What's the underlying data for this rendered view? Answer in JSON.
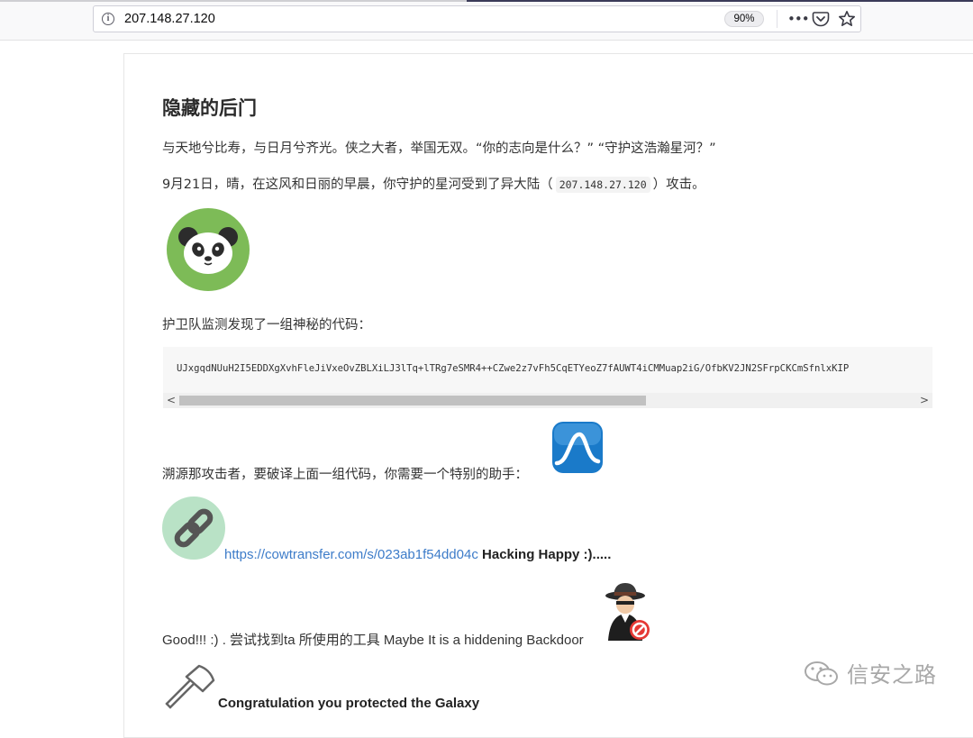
{
  "browser": {
    "url": "207.148.27.120",
    "zoom": "90%",
    "icons": [
      "info-icon",
      "more-icon",
      "pocket-icon",
      "star-icon"
    ]
  },
  "article": {
    "title": "隐藏的后门",
    "intro": "与天地兮比寿，与日月兮齐光。侠之大者，举国无双。“你的志向是什么？” “守护这浩瀚星河？”",
    "attack_prefix": "9月21日，晴，在这风和日丽的早晨，你守护的星河受到了异大陆（",
    "attack_ip": "207.148.27.120",
    "attack_suffix": "）攻击。",
    "found_code": "护卫队监测发现了一组神秘的代码：",
    "code": "UJxgqdNUuH2I5EDDXgXvhFleJiVxeOvZBLXiLJ3lTq+lTRg7eSMR4++CZwe2z7vFh5CqETYeoZ7fAUWT4iCMMuap2iG/OfbKV2JN2SFrpCKCmSfnlxKIP",
    "trace_text": "溯源那攻击者，要破译上面一组代码，你需要一个特别的助手：",
    "link_url": "https://cowtransfer.com/s/023ab1f54dd04c",
    "link_suffix": "Hacking Happy :).....",
    "hint": "Good!!! :) . 尝试找到ta 所使用的工具 Maybe It is a hiddening Backdoor",
    "congrats": "Congratulation you protected the Galaxy"
  },
  "watermark": {
    "text": "信安之路"
  },
  "colors": {
    "link": "#3d7cc9",
    "panda_bg": "#7dbb57",
    "wave_bg": "#1a7ac9",
    "chain_bg": "#b9e2c6"
  }
}
